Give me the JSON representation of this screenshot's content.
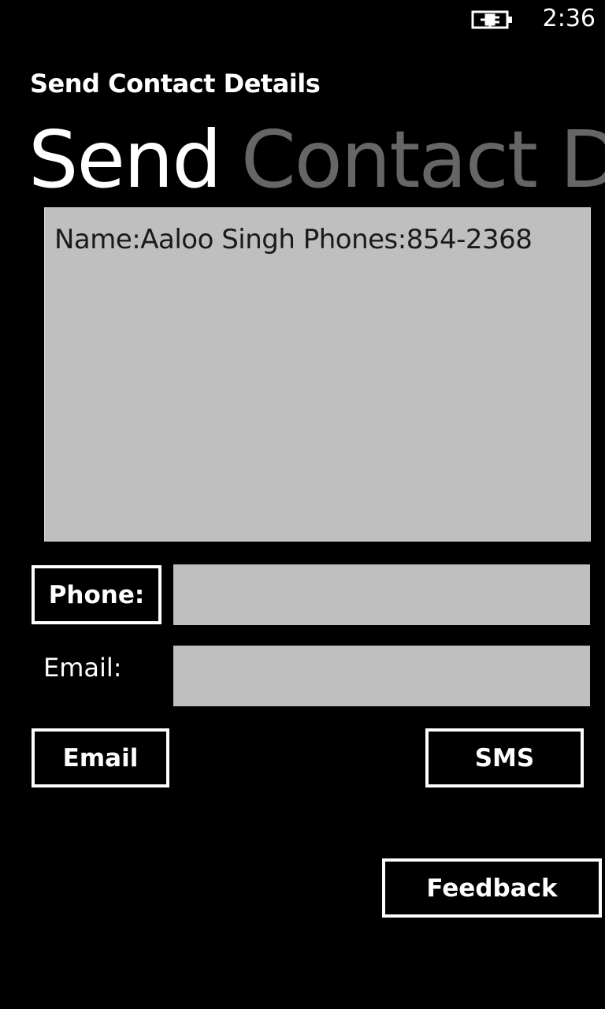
{
  "status_bar": {
    "time": "2:36",
    "battery_icon": "battery-charging-icon"
  },
  "app": {
    "title": "Send Contact Details"
  },
  "pivot": {
    "active": "Send",
    "next": "Contact D"
  },
  "contact_box": {
    "text": "Name:Aaloo Singh Phones:854-2368"
  },
  "form": {
    "phone_label": "Phone:",
    "phone_value": "",
    "email_label": "Email:",
    "email_value": ""
  },
  "actions": {
    "email_label": "Email",
    "sms_label": "SMS",
    "feedback_label": "Feedback"
  },
  "colors": {
    "background": "#000000",
    "foreground": "#ffffff",
    "input_fill": "#bfbfbf",
    "pivot_inactive": "#666666"
  }
}
